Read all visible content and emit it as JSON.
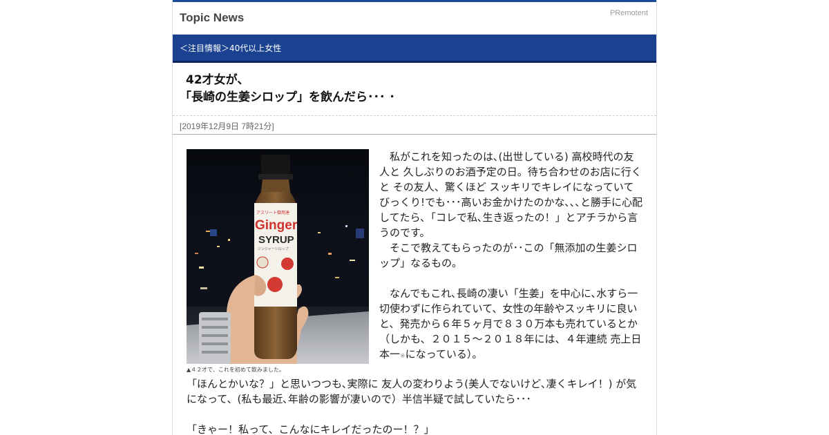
{
  "header": {
    "site_title": "Topic News",
    "pr_label": "PRemotent"
  },
  "nav": {
    "breadcrumb": "＜注目情報＞40代以上女性"
  },
  "article": {
    "title_lines": [
      "42才女が、",
      "「長崎の生姜シロップ」を飲んだら･･･ ･"
    ],
    "date": "[2019年12月9日 7時21分]",
    "image": {
      "bottle_brand": "アスリート御用達",
      "bottle_name_1": "Ginger",
      "bottle_name_2": "SYRUP",
      "bottle_sub": "ジンジャーシロップ",
      "caption": "▲４２才で、これを初めて飲みました。"
    },
    "side_paragraphs": [
      "　私がこれを知ったのは､(出世している) 高校時代の友人と 久しぶりのお酒予定の日。待ち合わせのお店に行くと その友人、驚くほど スッキリでキレイになっていてびっくり!でも･･･高いお金かけたのかな､､､と勝手に心配してたら､「コレで私､生き返ったの！」とアチラから言うのです。",
      "　そこで教えてもらったのが･･この「無添加の生姜シロップ」なるもの。",
      "",
      "　なんでもこれ､長崎の凄い「生姜」を中心に､水すら一切使わずに作られていて、女性の年齢やスッキリに良いと、発売から６年５ヶ月で８３０万本も売れているとか（しかも、２０１５～２０１８年には、４年連続 売上日本一",
      "※",
      "になっている）。"
    ],
    "full_paragraphs": [
      "「ほんとかいな？」と思いつつも､実際に 友人の変わりよう(美人でないけど､凄くキレイ！) が気になって、(私も最近､年齢の影響が凄いので）半信半疑で試していたら･･･",
      "",
      "「きゃー！私って、こんなにキレイだったのー！？」"
    ]
  }
}
